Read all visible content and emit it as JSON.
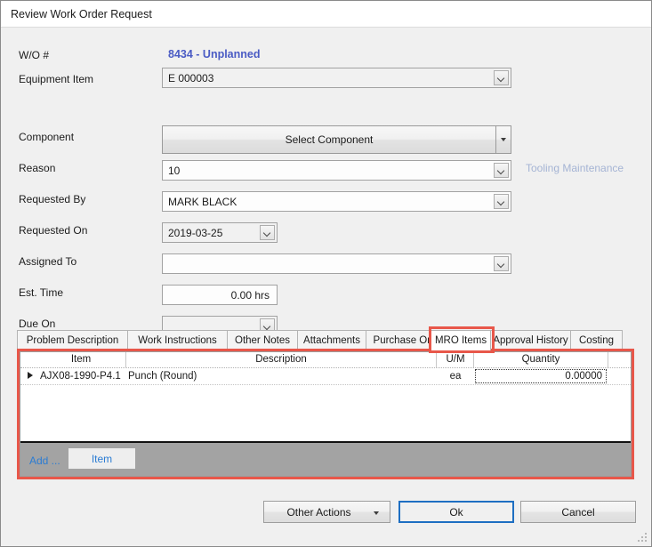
{
  "window": {
    "title": "Review Work Order Request"
  },
  "form": {
    "wo_number_label": "W/O #",
    "wo_number_value": "8434 - Unplanned",
    "equipment_item_label": "Equipment Item",
    "equipment_item_value": "E 000003",
    "component_label": "Component",
    "component_button_label": "Select Component",
    "reason_label": "Reason",
    "reason_value": "10",
    "reason_note": "Tooling Maintenance",
    "requested_by_label": "Requested By",
    "requested_by_value": "MARK BLACK",
    "requested_on_label": "Requested On",
    "requested_on_value": "2019-03-25",
    "assigned_to_label": "Assigned To",
    "assigned_to_value": "",
    "est_time_label": "Est. Time",
    "est_time_value": "0.00 hrs",
    "due_on_label": "Due On",
    "due_on_value": ""
  },
  "tabs": [
    {
      "label": "Problem Description",
      "active": false
    },
    {
      "label": "Work Instructions",
      "active": false
    },
    {
      "label": "Other Notes",
      "active": false
    },
    {
      "label": "Attachments",
      "active": false
    },
    {
      "label": "Purchase Orders",
      "active": false
    },
    {
      "label": "MRO Items",
      "active": true
    },
    {
      "label": "Approval History",
      "active": false
    },
    {
      "label": "Costing",
      "active": false
    }
  ],
  "grid": {
    "columns": [
      "Item",
      "Description",
      "U/M",
      "Quantity"
    ],
    "rows": [
      {
        "item": "AJX08-1990-P4.1",
        "description": "Punch (Round)",
        "um": "ea",
        "quantity": "0.00000"
      }
    ],
    "footer": {
      "add_link": "Add ...",
      "item_button": "Item"
    }
  },
  "actions": {
    "other_actions": "Other Actions",
    "ok": "Ok",
    "cancel": "Cancel"
  },
  "annotations": {
    "highlight_color": "#e8574a"
  }
}
